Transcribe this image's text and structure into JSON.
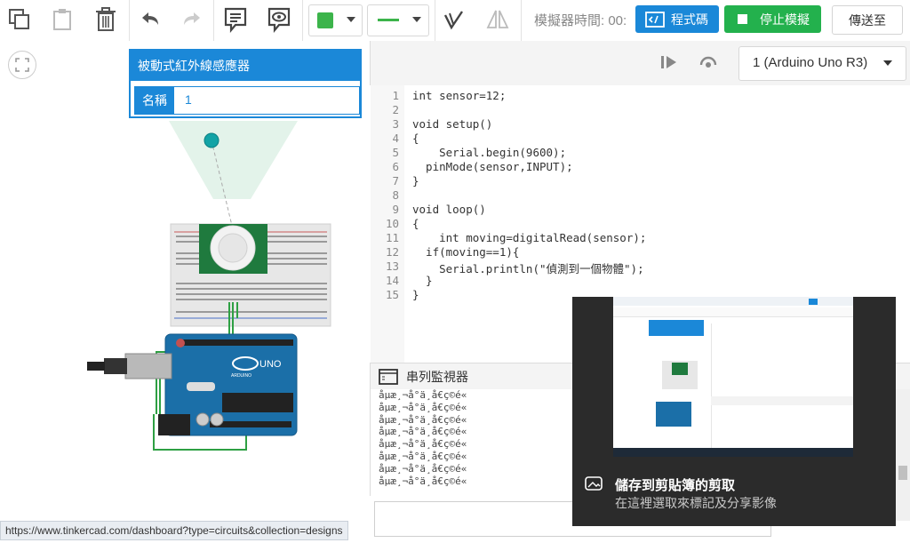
{
  "toolbar": {
    "sim_time_label": "模擬器時間: 00:",
    "code_button": "程式碼",
    "stop_sim_button": "停止模擬",
    "send_to_button": "傳送至",
    "fill_color": "#3cb44b",
    "line_color": "#3cb44b"
  },
  "props": {
    "title": "被動式紅外線感應器",
    "name_label": "名稱",
    "name_value": "1"
  },
  "code_panel": {
    "device_select": "1 (Arduino Uno R3)",
    "lines": [
      "int sensor=12;",
      "",
      "void setup()",
      "{",
      "    Serial.begin(9600);",
      "  pinMode(sensor,INPUT);",
      "}",
      "",
      "void loop()",
      "{",
      "    int moving=digitalRead(sensor);",
      "  if(moving==1){",
      "    Serial.println(\"偵測到一個物體\");",
      "  }",
      "}"
    ],
    "line_numbers": [
      "1",
      "2",
      "3",
      "4",
      "5",
      "6",
      "7",
      "8",
      "9",
      "10",
      "11",
      "12",
      "13",
      "14",
      "15"
    ]
  },
  "serial_monitor": {
    "title": "串列監視器",
    "lines": [
      "åµæ¸¬å°ä¸å€ç©é«",
      "åµæ¸¬å°ä¸å€ç©é«",
      "åµæ¸¬å°ä¸å€ç©é«",
      "åµæ¸¬å°ä¸å€ç©é«",
      "åµæ¸¬å°ä¸å€ç©é«",
      "åµæ¸¬å°ä¸å€ç©é«",
      "åµæ¸¬å°ä¸å€ç©é«",
      "åµæ¸¬å°ä¸å€ç©é«"
    ]
  },
  "status_url": "https://www.tinkercad.com/dashboard?type=circuits&collection=designs",
  "toast": {
    "title": "儲存到剪貼簿的剪取",
    "subtitle": "在這裡選取來標記及分享影像"
  },
  "board": {
    "uno_label": "UNO",
    "arduino_label": "ARDUINO"
  }
}
